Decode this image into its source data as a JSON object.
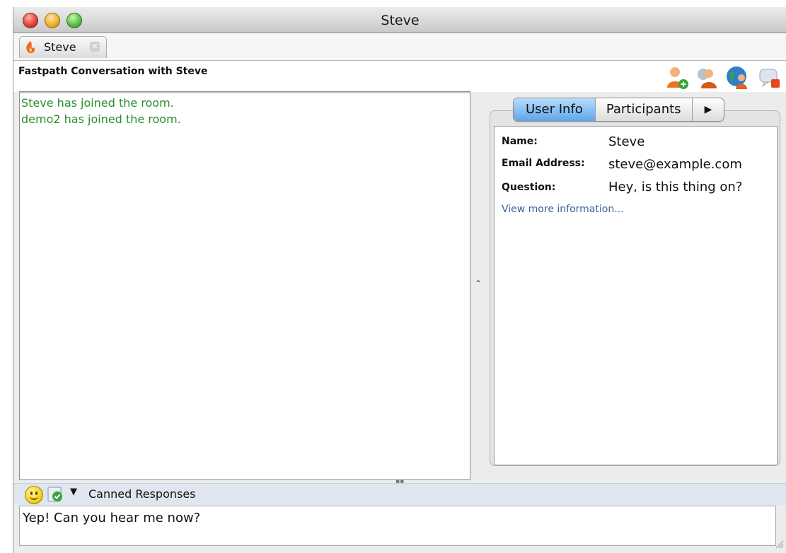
{
  "window": {
    "title": "Steve"
  },
  "tabs": [
    {
      "label": "Steve",
      "close_icon": "close-icon"
    }
  ],
  "header": {
    "conversation_title": "Fastpath Conversation with Steve",
    "actions": [
      "add-user-icon",
      "transfer-user-icon",
      "invite-user-icon",
      "end-chat-icon"
    ]
  },
  "chat": {
    "messages": [
      {
        "text": "Steve has joined the room.",
        "color": "#2a8f2a"
      },
      {
        "text": "demo2 has joined the room.",
        "color": "#2a8f2a"
      }
    ]
  },
  "side_panel": {
    "tabs": [
      {
        "label": "User Info",
        "selected": true
      },
      {
        "label": "Participants",
        "selected": false
      }
    ],
    "overflow_icon": "right-arrow-icon",
    "info": [
      {
        "key": "Name:",
        "value": "Steve"
      },
      {
        "key": "Email Address:",
        "value": "steve@example.com"
      },
      {
        "key": "Question:",
        "value": "Hey, is this thing on?"
      }
    ],
    "more_link": "View more information..."
  },
  "compose": {
    "emoticon_icon": "smiley-icon",
    "canned_icon": "canned-responses-icon",
    "canned_label": "Canned Responses",
    "text": "Yep! Can you hear me now?"
  },
  "colors": {
    "accent_tab": "#5ea6ea",
    "message_text": "#2a8f2a",
    "link": "#3a5ea0"
  }
}
